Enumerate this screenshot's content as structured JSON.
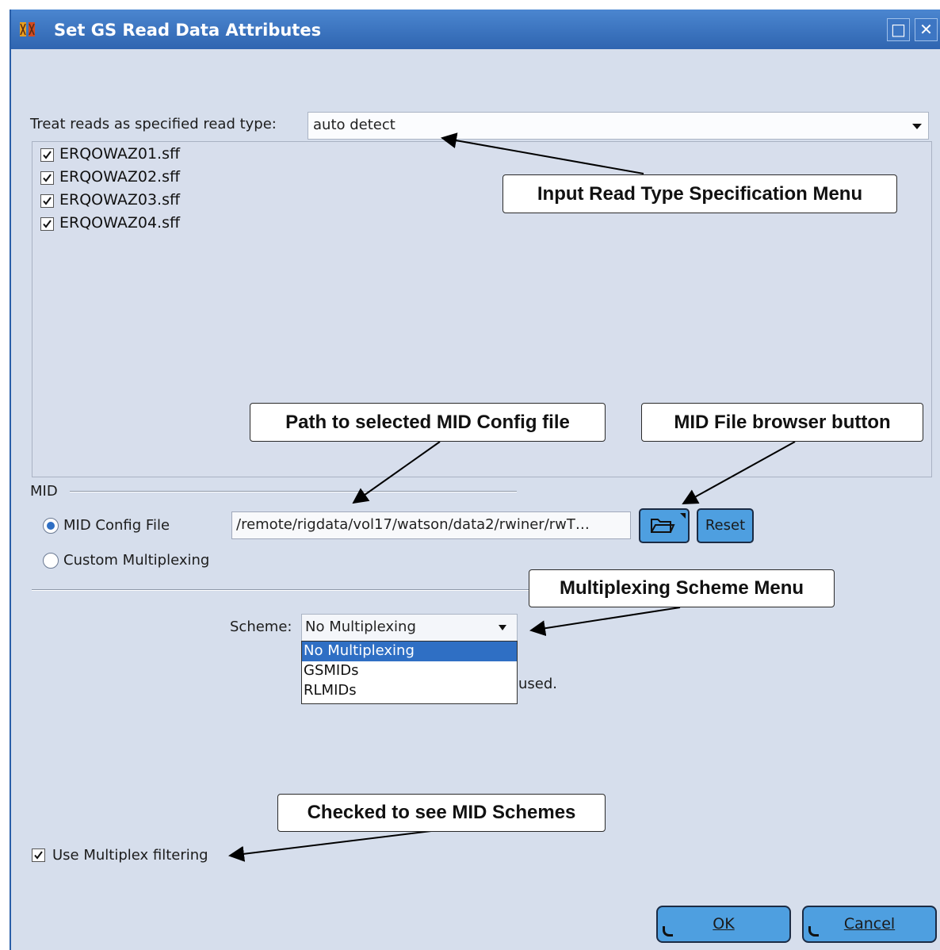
{
  "window": {
    "title": "Set GS Read Data Attributes",
    "maximize_icon": "□",
    "close_icon": "✕"
  },
  "read_type": {
    "label": "Treat reads as specified read type:",
    "value": "auto detect"
  },
  "files": [
    {
      "name": "ERQOWAZ01.sff",
      "checked": true
    },
    {
      "name": "ERQOWAZ02.sff",
      "checked": true
    },
    {
      "name": "ERQOWAZ03.sff",
      "checked": true
    },
    {
      "name": "ERQOWAZ04.sff",
      "checked": true
    }
  ],
  "mid": {
    "section_label": "MID",
    "config_file_label": "MID Config File",
    "config_file_selected": true,
    "config_path": "/remote/rigdata/vol17/watson/data2/rwiner/rwT…",
    "browse_icon": "folder-open-icon",
    "reset_label": "Reset",
    "custom_label": "Custom Multiplexing"
  },
  "scheme": {
    "label": "Scheme:",
    "value": "No Multiplexing",
    "options": [
      "No Multiplexing",
      "GSMIDs",
      "RLMIDs"
    ],
    "selected_index": 0,
    "partial_text": "used."
  },
  "filter": {
    "label": "Use Multiplex filtering",
    "checked": true
  },
  "buttons": {
    "ok": "OK",
    "cancel": "Cancel"
  },
  "callouts": {
    "input_read_type": "Input Read Type Specification Menu",
    "path_mid": "Path to selected MID Config file",
    "mid_browser": "MID File browser button",
    "multiplexing_menu": "Multiplexing Scheme Menu",
    "checked_schemes": "Checked to see MID Schemes"
  },
  "colors": {
    "window_bg": "#d6deec",
    "titlebar": "#2f65b0",
    "button_blue": "#4e9fe0",
    "selection": "#2f6fc4"
  }
}
